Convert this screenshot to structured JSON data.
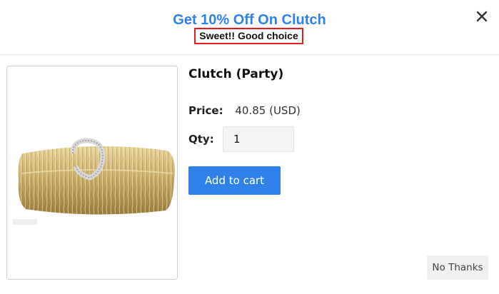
{
  "header": {
    "title": "Get 10% Off On Clutch",
    "subtitle": "Sweet!! Good choice",
    "close_icon": "close-icon"
  },
  "product": {
    "name": "Clutch (Party)",
    "price_label": "Price:",
    "price_value": "40.85 (USD)",
    "qty_label": "Qty:",
    "qty_value": "1",
    "image_icon": "gold-clutch-purse-image"
  },
  "actions": {
    "add_to_cart": "Add to cart",
    "no_thanks": "No Thanks"
  },
  "colors": {
    "accent": "#2f80e8",
    "highlight_border": "#e0201b",
    "gold": "#c9ad6a"
  }
}
